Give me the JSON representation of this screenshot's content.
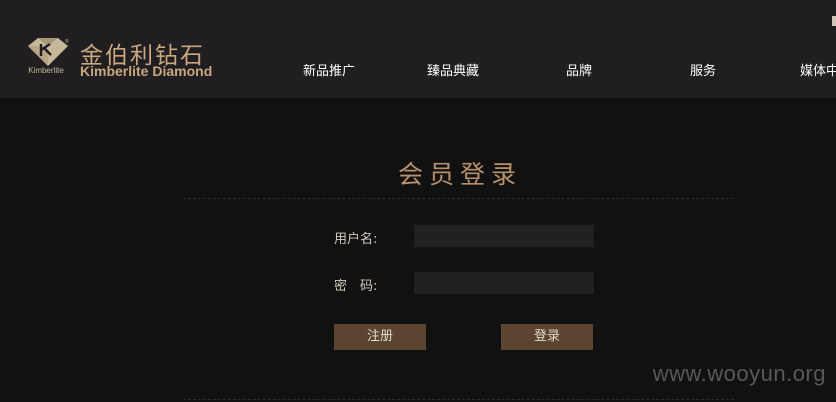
{
  "brand": {
    "mark_text": "Kimberlite",
    "name_cn": "金伯利钻石",
    "name_en": "Kimberlite Diamond"
  },
  "nav": {
    "items": [
      {
        "label": "新品推广"
      },
      {
        "label": "臻品典藏"
      },
      {
        "label": "品牌"
      },
      {
        "label": "服务"
      },
      {
        "label": "媒体中"
      }
    ]
  },
  "login": {
    "title": "会员登录",
    "username_label": "用户名:",
    "username_value": "",
    "password_label": "密　码:",
    "password_value": "",
    "register_button": "注册",
    "login_button": "登录"
  },
  "watermark": "www.wooyun.org",
  "colors": {
    "header_bg": "#201e20",
    "page_bg": "#121111",
    "accent_gold": "#b8906b",
    "button_bg": "#5b4530"
  }
}
